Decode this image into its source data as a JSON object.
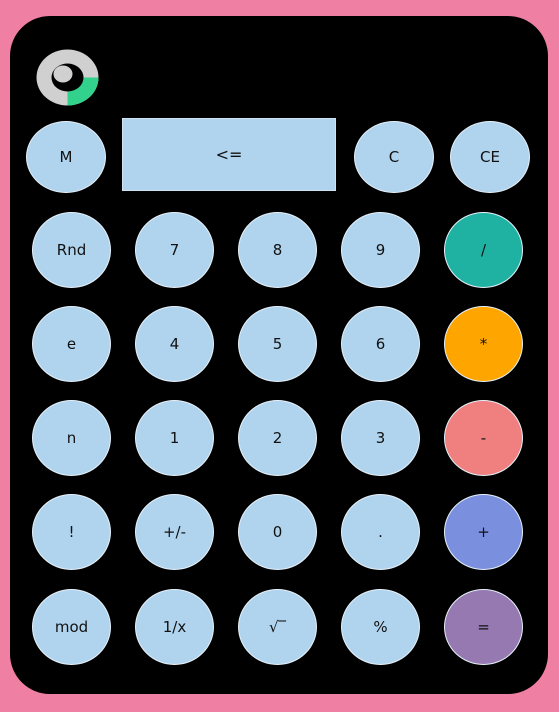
{
  "display": {
    "backspace_label": "<="
  },
  "row0": {
    "m": "M",
    "c": "C",
    "ce": "CE"
  },
  "keys": {
    "rnd": "Rnd",
    "seven": "7",
    "eight": "8",
    "nine": "9",
    "divide": "/",
    "e": "e",
    "four": "4",
    "five": "5",
    "six": "6",
    "multiply": "*",
    "n": "n",
    "one": "1",
    "two": "2",
    "three": "3",
    "minus": "-",
    "fact": "!",
    "plusminus": "+/-",
    "zero": "0",
    "dot": ".",
    "plus": "+",
    "mod": "mod",
    "recip": "1/x",
    "sqrt": "√‾",
    "percent": "%",
    "equals": "="
  },
  "colors": {
    "background": "#f07fa4",
    "body": "#000000",
    "key": "#b0d4ee",
    "divide": "#1fb2a2",
    "multiply": "#ffa500",
    "minus": "#f08080",
    "plus": "#7b8fdf",
    "equals": "#9679b0",
    "logo_gray": "#d0d0d0",
    "logo_green": "#33d28c"
  },
  "icons": {
    "logo": "donut-logo-icon"
  }
}
